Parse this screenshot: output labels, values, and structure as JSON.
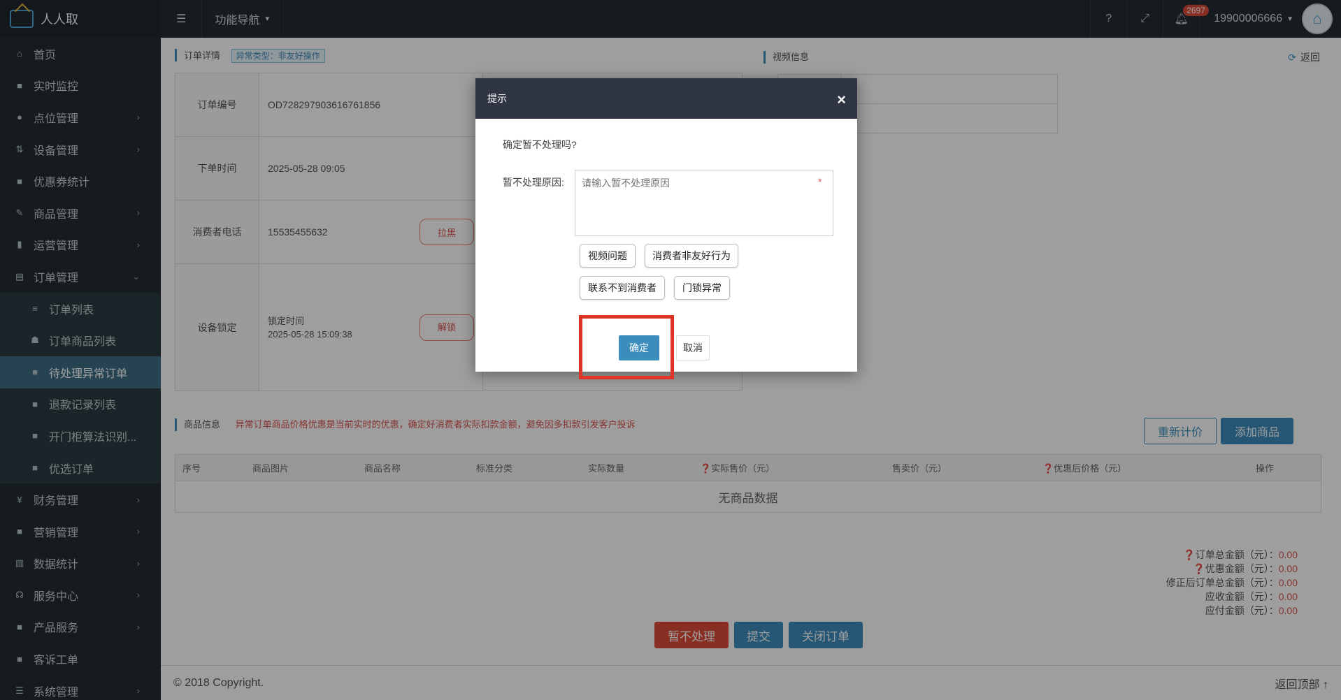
{
  "app": {
    "title": "人人取",
    "nav_menu": "功能导航",
    "user": "19900006666",
    "notification_count": "2697",
    "help": "?"
  },
  "sidebar": {
    "items": [
      {
        "label": "首页",
        "icon": "home-icon",
        "glyph": "⌂",
        "arrow": ""
      },
      {
        "label": "实时监控",
        "icon": "video-icon",
        "glyph": "■",
        "arrow": ""
      },
      {
        "label": "点位管理",
        "icon": "location-icon",
        "glyph": "●",
        "arrow": "›"
      },
      {
        "label": "设备管理",
        "icon": "sort-icon",
        "glyph": "⇅",
        "arrow": "›"
      },
      {
        "label": "优惠券统计",
        "icon": "square-icon",
        "glyph": "■",
        "arrow": ""
      },
      {
        "label": "商品管理",
        "icon": "edit-icon",
        "glyph": "✎",
        "arrow": "›"
      },
      {
        "label": "运营管理",
        "icon": "bookmark-icon",
        "glyph": "▮",
        "arrow": "›"
      },
      {
        "label": "订单管理",
        "icon": "list-icon",
        "glyph": "▤",
        "arrow": "⌄"
      }
    ],
    "sub_items": [
      {
        "label": "订单列表",
        "icon": "bars-icon",
        "glyph": "≡"
      },
      {
        "label": "订单商品列表",
        "icon": "sitemap-icon",
        "glyph": "☗"
      },
      {
        "label": "待处理异常订单",
        "icon": "square-icon",
        "glyph": "■"
      },
      {
        "label": "退款记录列表",
        "icon": "square-icon",
        "glyph": "■"
      },
      {
        "label": "开门柜算法识别...",
        "icon": "square-icon",
        "glyph": "■"
      },
      {
        "label": "优选订单",
        "icon": "square-icon",
        "glyph": "■"
      }
    ],
    "items_after": [
      {
        "label": "财务管理",
        "icon": "yen-icon",
        "glyph": "¥",
        "arrow": "›"
      },
      {
        "label": "营销管理",
        "icon": "gift-icon",
        "glyph": "■",
        "arrow": "›"
      },
      {
        "label": "数据统计",
        "icon": "bar-chart-icon",
        "glyph": "▥",
        "arrow": "›"
      },
      {
        "label": "服务中心",
        "icon": "headset-icon",
        "glyph": "☊",
        "arrow": "›"
      },
      {
        "label": "产品服务",
        "icon": "square-icon",
        "glyph": "■",
        "arrow": "›"
      },
      {
        "label": "客诉工单",
        "icon": "square-icon",
        "glyph": "■",
        "arrow": ""
      },
      {
        "label": "系统管理",
        "icon": "th-list-icon",
        "glyph": "☰",
        "arrow": "›"
      }
    ]
  },
  "order": {
    "section_title": "订单详情",
    "tag": "异常类型：非友好操作",
    "rows": [
      {
        "label": "订单编号",
        "value": "OD728297903616761856"
      },
      {
        "label": "下单时间",
        "value": "2025-05-28 09:05"
      },
      {
        "label": "消费者电话",
        "value": "15535455632",
        "button": "拉黑"
      },
      {
        "label": "设备锁定",
        "value": "锁定时间",
        "value2": "2025-05-28 15:09:38",
        "button": "解锁"
      }
    ]
  },
  "video": {
    "section_title": "视频信息",
    "back": "返回"
  },
  "goods": {
    "section_title": "商品信息",
    "warning": "异常订单商品价格优惠是当前实时的优惠，确定好消费者实际扣款金额，避免因多扣款引发客户投诉",
    "btn_reprice": "重新计价",
    "btn_add": "添加商品",
    "columns": [
      "序号",
      "商品图片",
      "商品名称",
      "标准分类",
      "实际数量",
      "❓实际售价（元）",
      "售卖价（元）",
      "❓优惠后价格（元）",
      "操作"
    ],
    "empty": "无商品数据"
  },
  "totals": [
    {
      "label": "❓订单总金额（元）：",
      "value": "0.00"
    },
    {
      "label": "❓优惠金额（元）：",
      "value": "0.00"
    },
    {
      "label": "修正后订单总金额（元）：",
      "value": "0.00"
    },
    {
      "label": "应收金额（元）：",
      "value": "0.00"
    },
    {
      "label": "应付金额（元）：",
      "value": "0.00"
    }
  ],
  "actions": {
    "hold": "暂不处理",
    "submit": "提交",
    "close": "关闭订单"
  },
  "footer": {
    "copyright": "© 2018 Copyright.",
    "back_top": "返回顶部 ↑"
  },
  "modal": {
    "title": "提示",
    "close": "×",
    "question": "确定暂不处理吗?",
    "reason_label": "暂不处理原因:",
    "reason_placeholder": "请输入暂不处理原因",
    "required_mark": "*",
    "chips": [
      "视频问题",
      "消费者非友好行为",
      "联系不到消费者",
      "门锁异常"
    ],
    "ok": "确定",
    "cancel": "取消"
  },
  "colors": {
    "primary": "#3c8dbc",
    "danger": "#d9534f",
    "sidebar": "#222d32",
    "highlight": "#e03426"
  }
}
